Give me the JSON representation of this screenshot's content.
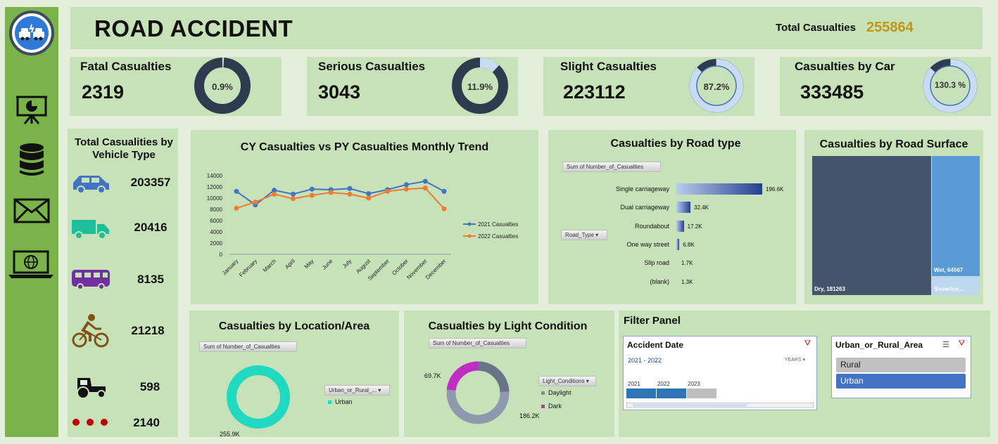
{
  "header": {
    "title": "ROAD ACCIDENT",
    "total_label": "Total Casualties",
    "total_value": "255864"
  },
  "sidebar": {
    "icons": [
      "car-crash-logo-icon",
      "presentation-chart-icon",
      "database-icon",
      "mail-icon",
      "laptop-globe-icon"
    ]
  },
  "kpis": [
    {
      "label": "Fatal Casualties",
      "value": "2319",
      "pct_label": "0.9%",
      "pct": 0.9
    },
    {
      "label": "Serious Casualties",
      "value": "3043",
      "pct_label": "11.9%",
      "pct": 11.9
    },
    {
      "label": "Slight Casualties",
      "value": "223112",
      "pct_label": "87.2%",
      "pct": 87.2
    },
    {
      "label": "Casualties by Car",
      "value": "333485",
      "pct_label": "130.3 %",
      "pct": 130.3
    }
  ],
  "vehicle": {
    "title": "Total Casualities by Vehicle Type",
    "items": [
      {
        "icon": "car-icon",
        "value": "203357",
        "color": "#4472c4"
      },
      {
        "icon": "truck-icon",
        "value": "20416",
        "color": "#1dbf9a"
      },
      {
        "icon": "bus-icon",
        "value": "8135",
        "color": "#7030a0"
      },
      {
        "icon": "bicycle-icon",
        "value": "21218",
        "color": "#7f5217"
      },
      {
        "icon": "tractor-icon",
        "value": "598",
        "color": "#111111"
      },
      {
        "icon": "dots-icon",
        "value": "2140",
        "color": "#c00000"
      }
    ]
  },
  "trend": {
    "title": "CY Casualties vs PY Casualties Monthly Trend",
    "chart_data": {
      "type": "line",
      "categories": [
        "January",
        "February",
        "March",
        "April",
        "May",
        "June",
        "July",
        "August",
        "September",
        "October",
        "November",
        "December"
      ],
      "series": [
        {
          "name": "2021 Casualties",
          "color": "#4472c4",
          "values": [
            11200,
            8800,
            11400,
            10700,
            11600,
            11500,
            11700,
            10800,
            11500,
            12400,
            13000,
            11200
          ]
        },
        {
          "name": "2022 Casualties",
          "color": "#ed7d31",
          "values": [
            8200,
            9300,
            10700,
            9900,
            10500,
            11000,
            10700,
            10000,
            11200,
            11600,
            11800,
            8100
          ]
        }
      ],
      "yticks": [
        "14000",
        "12000",
        "10000",
        "8000",
        "6000",
        "4000",
        "2000",
        "0"
      ],
      "ylim": [
        0,
        14000
      ]
    }
  },
  "road_type": {
    "title": "Casualties by Road type",
    "field_button": "Sum of Number_of_Casualties",
    "filter_button": "Road_Type",
    "chart_data": {
      "type": "bar",
      "categories": [
        "Single carriageway",
        "Dual carriageway",
        "Roundabout",
        "One way street",
        "Slip road",
        "(blank)"
      ],
      "values": [
        196.6,
        32.4,
        17.2,
        6.8,
        1.7,
        1.3
      ],
      "value_labels": [
        "196.6K",
        "32.4K",
        "17.2K",
        "6.8K",
        "1.7K",
        "1.3K"
      ]
    }
  },
  "surface": {
    "title": "Casualties by Road Surface",
    "chart_data": {
      "type": "treemap",
      "categories": [
        "Dry",
        "Wet",
        "Snow/Ice,..."
      ],
      "values": [
        181263,
        64567,
        null
      ],
      "labels": [
        "Dry, 181263",
        "Wet, 64567",
        "Snow/ice,..."
      ],
      "colors": [
        "#44546a",
        "#5b9bd5",
        "#bdd7ee"
      ]
    }
  },
  "location": {
    "title": "Casualties by Location/Area",
    "field_button": "Sum of Number_of_Casualties",
    "filter_button": "Urban_or_Rural_...",
    "legend": "Urban",
    "chart_data": {
      "type": "pie",
      "categories": [
        "Urban"
      ],
      "values": [
        255.9
      ],
      "value_labels": [
        "255.9K"
      ]
    }
  },
  "light": {
    "title": "Casualties by Light Condition",
    "field_button": "Sum of Number_of_Casualties",
    "filter_button": "Light_Conditions",
    "chart_data": {
      "type": "pie",
      "categories": [
        "Daylight",
        "Dark"
      ],
      "values": [
        186.2,
        69.7
      ],
      "value_labels": [
        "186.2K",
        "69.7K"
      ],
      "colors": [
        "#7f8ba3",
        "#c02dc4"
      ]
    }
  },
  "filter": {
    "title": "Filter Panel",
    "date": {
      "title": "Accident Date",
      "range": "2021 - 2022",
      "level": "YEARS",
      "years": [
        "2021",
        "2022",
        "2023"
      ]
    },
    "area": {
      "title": "Urban_or_Rural_Area",
      "options": [
        "Rural",
        "Urban"
      ],
      "selected": "Urban"
    }
  }
}
